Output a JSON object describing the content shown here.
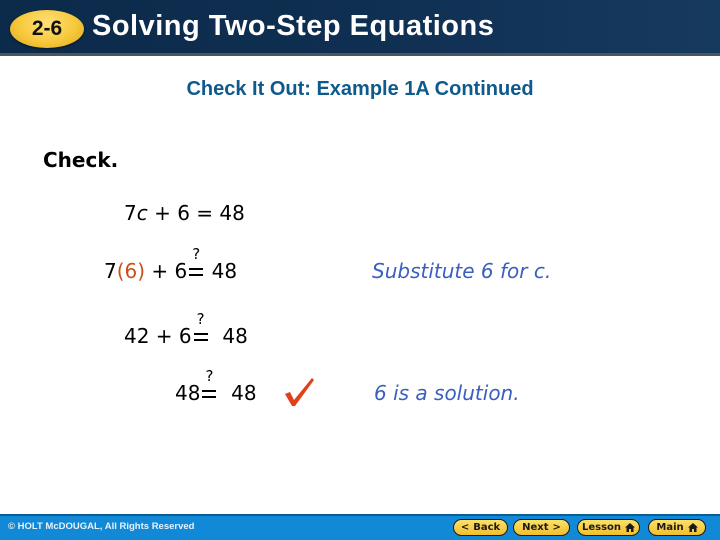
{
  "header": {
    "lesson_number": "2-6",
    "title": "Solving Two-Step Equations"
  },
  "subtitle": "Check It Out: Example 1A Continued",
  "check_label": "Check.",
  "equations": [
    {
      "parts": {
        "a": "7",
        "var": "c",
        "b": " + 6 = 48"
      }
    },
    {
      "parts": {
        "a": "7",
        "sub": "(6)",
        "b": " + 6",
        "rel": "?=",
        "c": " 48"
      }
    },
    {
      "parts": {
        "a": "42 + 6",
        "rel": "?=",
        "c": "  48"
      }
    },
    {
      "parts": {
        "a": "48",
        "rel": "?=",
        "c": "  48"
      }
    }
  ],
  "notes": {
    "substitute": "Substitute 6 for c.",
    "solution": "6 is a solution."
  },
  "question_mark": "?",
  "footer": {
    "copyright": "© HOLT McDOUGAL, All Rights Reserved",
    "buttons": [
      {
        "label": "Back",
        "icon": "chevron-left-icon",
        "glyph": "<"
      },
      {
        "label": "Next",
        "icon": "chevron-right-icon",
        "glyph": ">"
      },
      {
        "label": "Lesson",
        "icon": "home-icon"
      },
      {
        "label": "Main",
        "icon": "home-icon"
      }
    ]
  },
  "colors": {
    "header_bg": "#0f2f52",
    "badge": "#f6c83a",
    "subtitle": "#0d5a8c",
    "substitution": "#c8501e",
    "notes": "#3b5fc0",
    "checkmark": "#e0401a",
    "footer_bg": "#1289d6"
  }
}
